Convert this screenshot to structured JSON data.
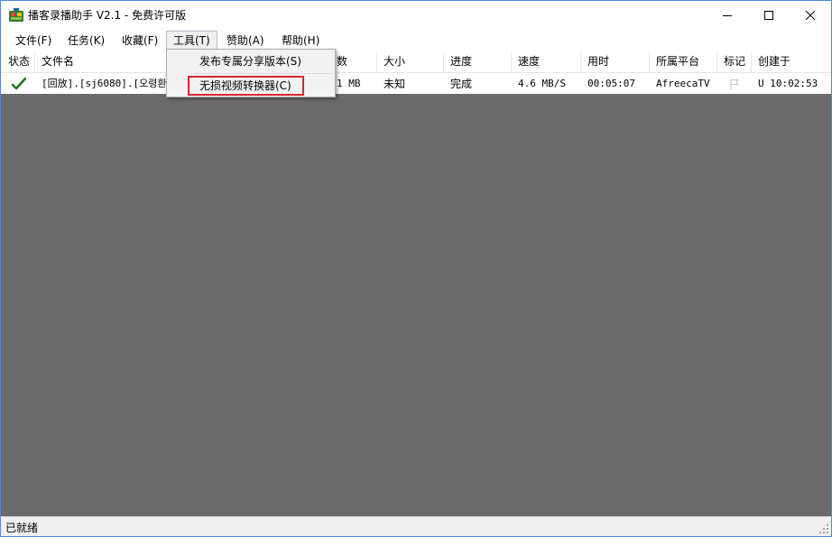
{
  "window": {
    "title": "播客录播助手 V2.1 - 免费许可版"
  },
  "menubar": {
    "items": [
      "文件(F)",
      "任务(K)",
      "收藏(F)",
      "工具(T)",
      "赞助(A)",
      "帮助(H)"
    ],
    "active_index": 3
  },
  "tools_menu": {
    "items": [
      "发布专属分享版本(S)",
      "无损视频转换器(C)"
    ]
  },
  "list": {
    "columns": [
      "状态",
      "文件名",
      "数",
      "大小",
      "进度",
      "速度",
      "用时",
      "所属平台",
      "标记",
      "创建于"
    ],
    "rows": [
      {
        "status_icon": "check-icon",
        "filename": "[回放].[sj6080].[오령환]",
        "count": "1 MB",
        "size": "未知",
        "progress": "完成",
        "speed": "4.6 MB/S",
        "elapsed": "00:05:07",
        "platform": "AfreecaTV",
        "mark_icon": "flag-icon",
        "created": "U 10:02:53"
      }
    ]
  },
  "statusbar": {
    "text": "已就绪"
  },
  "colors": {
    "client_bg": "#6b6b6b",
    "check": "#1e7a1e",
    "highlight": "#d9262b"
  }
}
